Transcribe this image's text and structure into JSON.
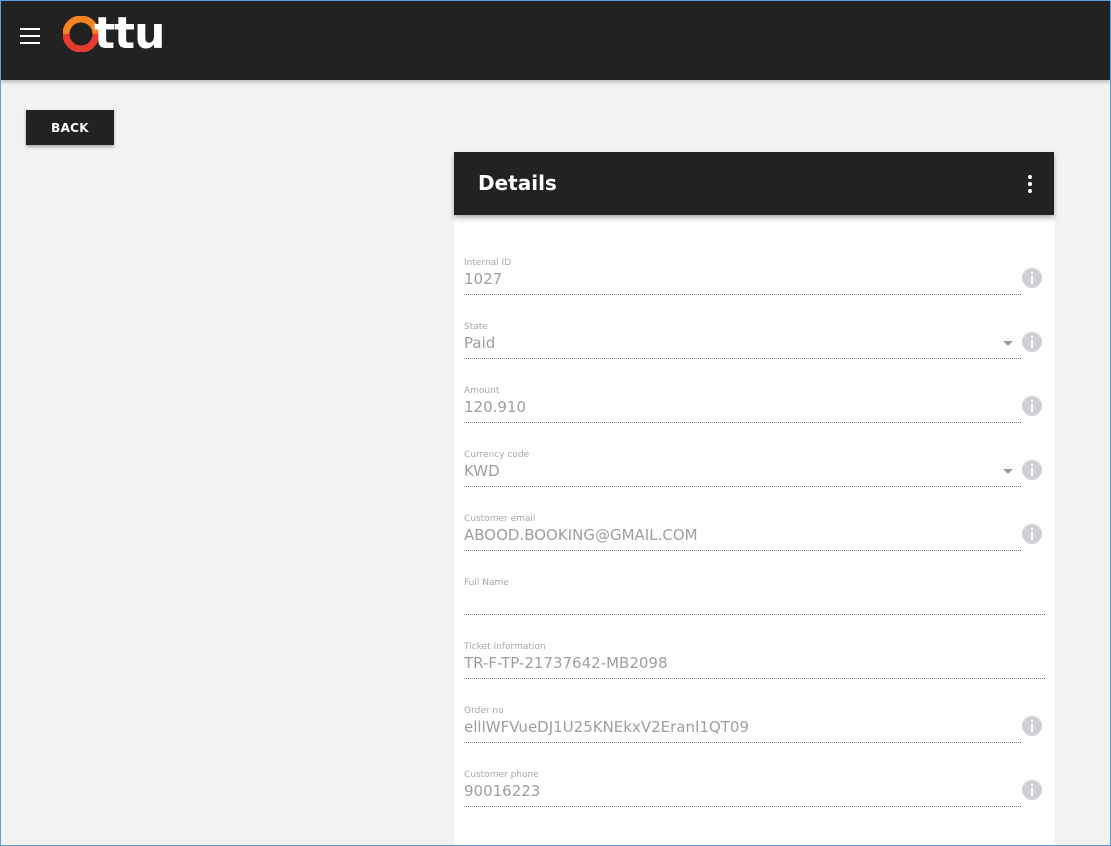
{
  "brand": {
    "logo_text": "ttu",
    "logo_full": "Ottu",
    "colors": {
      "ring_orange": "#f5831f",
      "ring_red": "#e63b2e",
      "header_bg": "#222222"
    }
  },
  "topbar": {
    "menu_icon": "hamburger-menu-icon"
  },
  "actions": {
    "back_label": "BACK"
  },
  "details": {
    "title": "Details",
    "menu_icon": "more-vertical-icon",
    "fields": [
      {
        "label": "Internal ID",
        "value": "1027",
        "dropdown": false,
        "info": true
      },
      {
        "label": "State",
        "value": "Paid",
        "dropdown": true,
        "info": true
      },
      {
        "label": "Amount",
        "value": "120.910",
        "dropdown": false,
        "info": true
      },
      {
        "label": "Currency code",
        "value": "KWD",
        "dropdown": true,
        "info": true
      },
      {
        "label": "Customer email",
        "value": "ABOOD.BOOKING@GMAIL.COM",
        "dropdown": false,
        "info": true
      },
      {
        "label": "Full Name",
        "value": "",
        "dropdown": false,
        "info": false
      },
      {
        "label": "Ticket Information",
        "value": "TR-F-TP-21737642-MB2098",
        "dropdown": false,
        "info": false
      },
      {
        "label": "Order no",
        "value": "elllWFVueDJ1U25KNEkxV2EranI1QT09",
        "dropdown": false,
        "info": true
      },
      {
        "label": "Customer phone",
        "value": "90016223",
        "dropdown": false,
        "info": true
      }
    ]
  }
}
